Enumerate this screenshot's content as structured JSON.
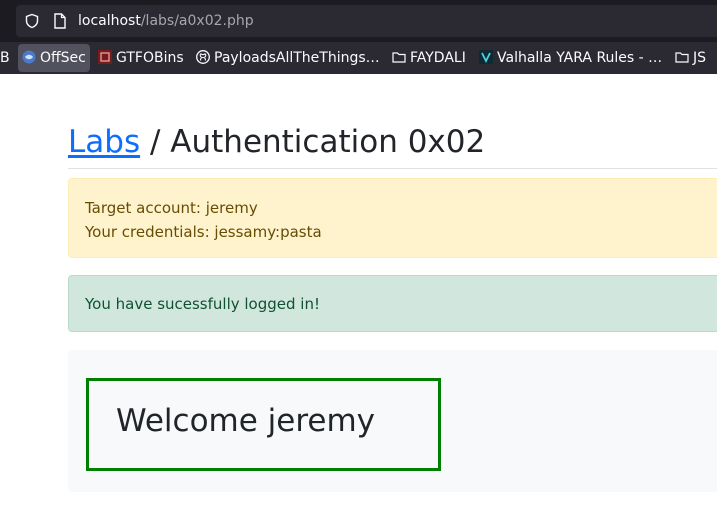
{
  "browser": {
    "url_host": "localhost",
    "url_path": "/labs/a0x02.php",
    "bookmarks": [
      {
        "label": "B",
        "icon": "bookmark-partial-icon"
      },
      {
        "label": "OffSec",
        "icon": "offsec-favicon"
      },
      {
        "label": "GTFOBins",
        "icon": "gtfobins-favicon"
      },
      {
        "label": "PayloadsAllTheThings…",
        "icon": "github-icon"
      },
      {
        "label": "FAYDALI",
        "icon": "folder-icon"
      },
      {
        "label": "Valhalla YARA Rules - …",
        "icon": "valhalla-favicon"
      },
      {
        "label": "JS",
        "icon": "folder-icon"
      }
    ]
  },
  "page": {
    "breadcrumb_link": "Labs",
    "breadcrumb_separator": "/",
    "title": "Authentication 0x02",
    "warning": {
      "line1": "Target account: jeremy",
      "line2": "Your credentials: jessamy:pasta"
    },
    "success": "You have sucessfully logged in!",
    "welcome": "Welcome jeremy"
  },
  "colors": {
    "link": "#0d6efd",
    "warning_bg": "#fff3cd",
    "success_bg": "#d1e7dd",
    "welcome_border": "#008000"
  }
}
